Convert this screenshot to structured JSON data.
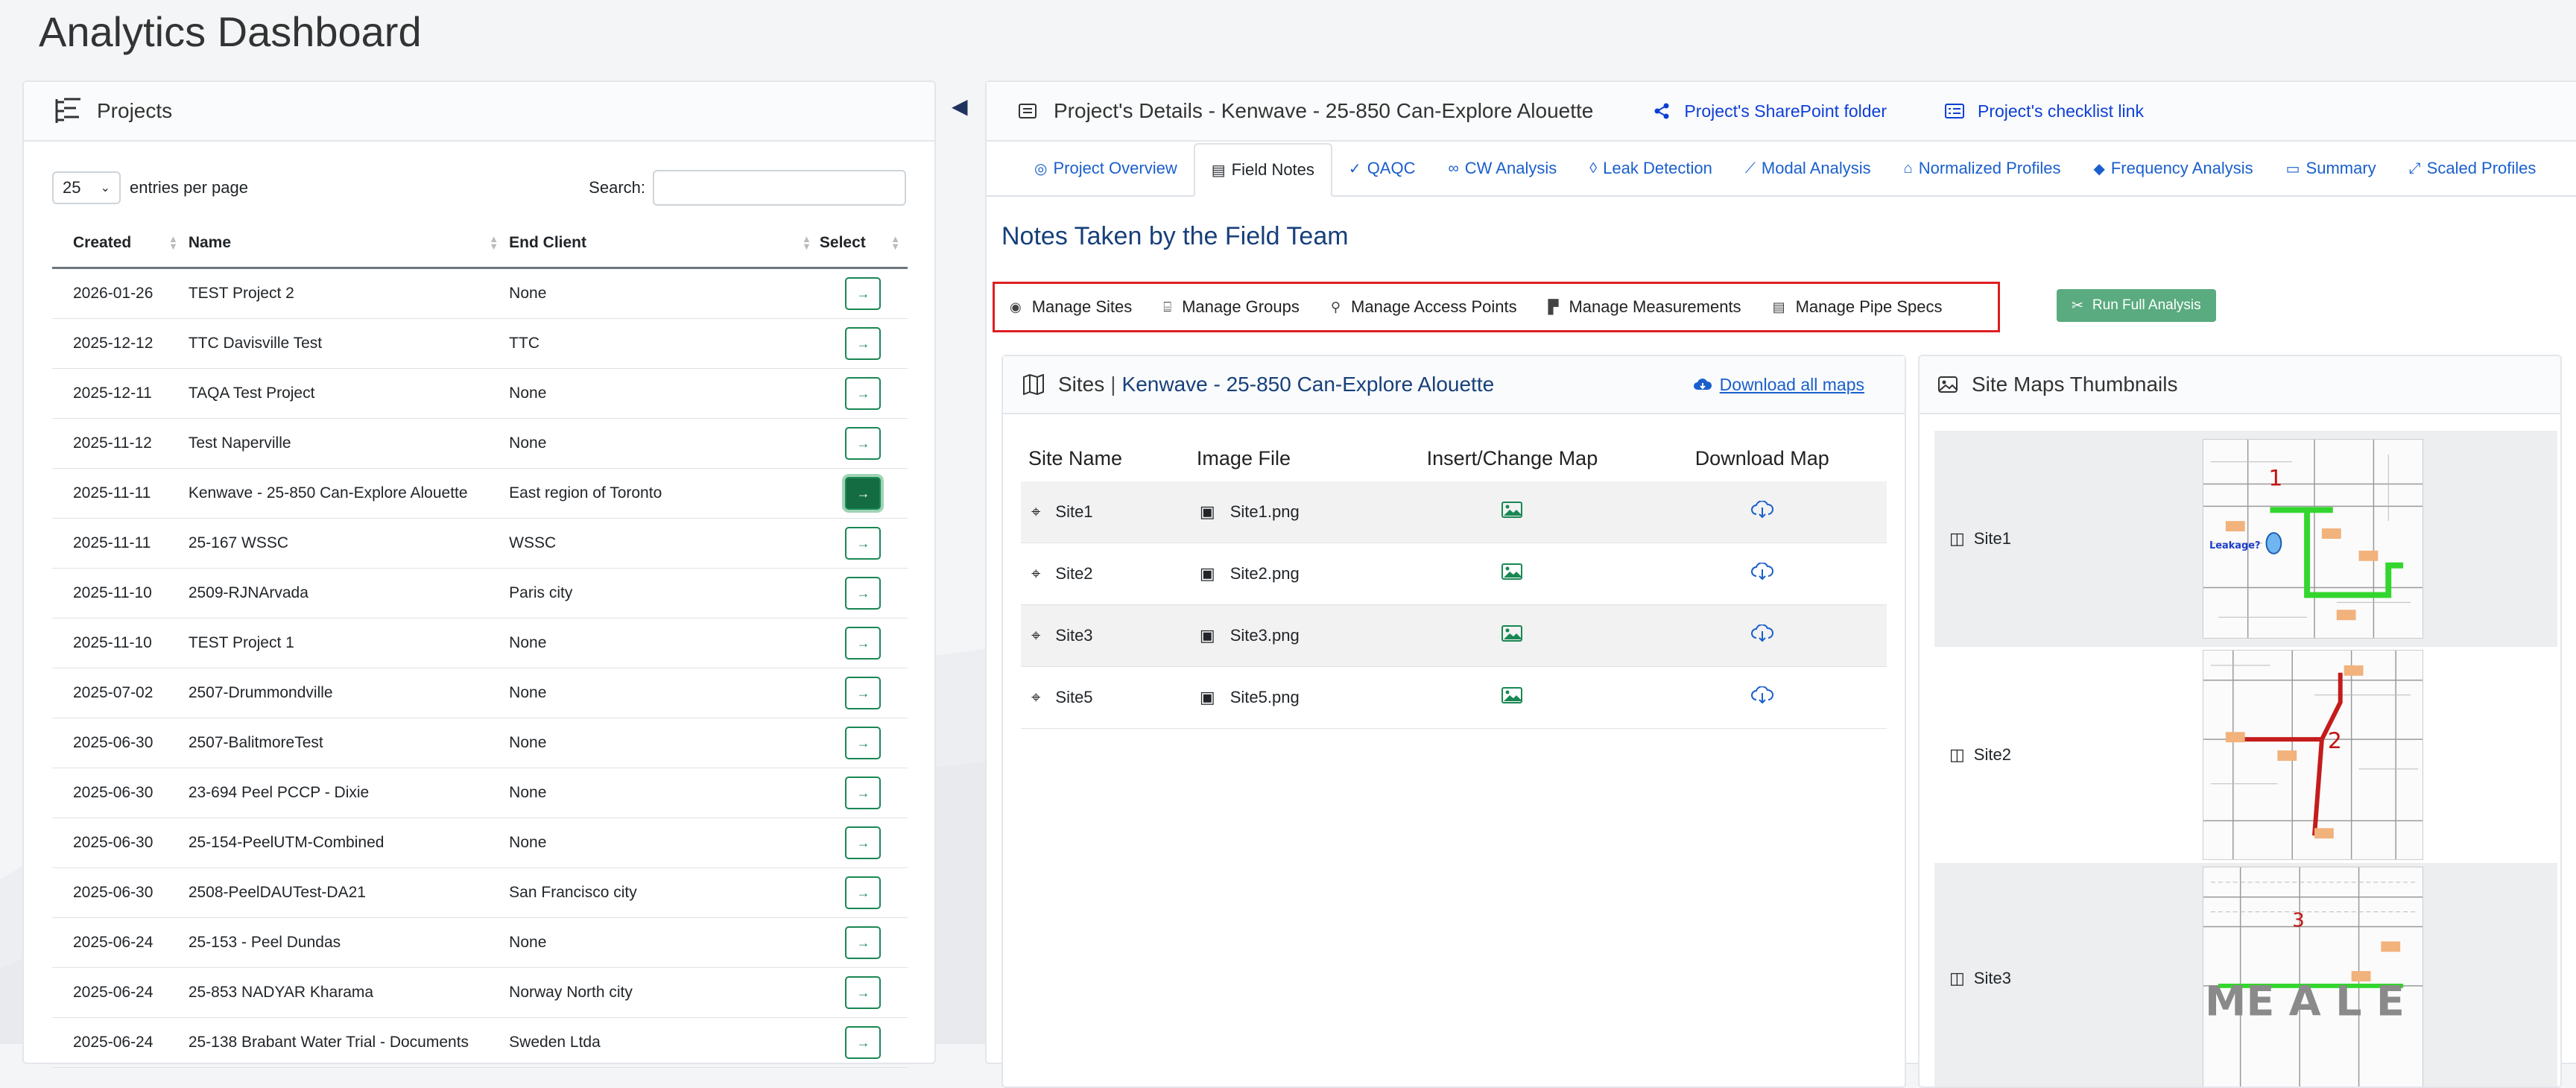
{
  "page_title": "Analytics Dashboard",
  "projects": {
    "header": "Projects",
    "entries_value": "25",
    "entries_label": "entries per page",
    "search_label": "Search:",
    "search_value": "",
    "columns": [
      "Created",
      "Name",
      "End Client",
      "Select"
    ],
    "select_glyph": "→",
    "rows": [
      {
        "created": "2026-01-26",
        "name": "TEST Project 2",
        "client": "None",
        "active": false
      },
      {
        "created": "2025-12-12",
        "name": "TTC Davisville Test",
        "client": "TTC",
        "active": false
      },
      {
        "created": "2025-12-11",
        "name": "TAQA Test Project",
        "client": "None",
        "active": false
      },
      {
        "created": "2025-11-12",
        "name": "Test Naperville",
        "client": "None",
        "active": false
      },
      {
        "created": "2025-11-11",
        "name": "Kenwave - 25-850 Can-Explore Alouette",
        "client": "East region of Toronto",
        "active": true
      },
      {
        "created": "2025-11-11",
        "name": "25-167 WSSC",
        "client": "WSSC",
        "active": false
      },
      {
        "created": "2025-11-10",
        "name": "2509-RJNArvada",
        "client": "Paris city",
        "active": false
      },
      {
        "created": "2025-11-10",
        "name": "TEST Project 1",
        "client": "None",
        "active": false
      },
      {
        "created": "2025-07-02",
        "name": "2507-Drummondville",
        "client": "None",
        "active": false
      },
      {
        "created": "2025-06-30",
        "name": "2507-BalitmoreTest",
        "client": "None",
        "active": false
      },
      {
        "created": "2025-06-30",
        "name": "23-694 Peel PCCP - Dixie",
        "client": "None",
        "active": false
      },
      {
        "created": "2025-06-30",
        "name": "25-154-PeelUTM-Combined",
        "client": "None",
        "active": false
      },
      {
        "created": "2025-06-30",
        "name": "2508-PeelDAUTest-DA21",
        "client": "San Francisco city",
        "active": false
      },
      {
        "created": "2025-06-24",
        "name": "25-153 - Peel Dundas",
        "client": "None",
        "active": false
      },
      {
        "created": "2025-06-24",
        "name": "25-853 NADYAR Kharama",
        "client": "Norway North city",
        "active": false
      },
      {
        "created": "2025-06-24",
        "name": "25-138 Brabant Water Trial - Documents",
        "client": "Sweden Ltda",
        "active": false
      }
    ]
  },
  "details": {
    "title": "Project's Details - Kenwave - 25-850 Can-Explore Alouette",
    "sharepoint_link": "Project's SharePoint folder",
    "checklist_link": "Project's checklist link",
    "tabs": [
      {
        "label": "Project Overview",
        "icon": "◎"
      },
      {
        "label": "Field Notes",
        "icon": "▤",
        "active": true
      },
      {
        "label": "QAQC",
        "icon": "✓"
      },
      {
        "label": "CW Analysis",
        "icon": "∞"
      },
      {
        "label": "Leak Detection",
        "icon": "◊"
      },
      {
        "label": "Modal Analysis",
        "icon": "⟋"
      },
      {
        "label": "Normalized Profiles",
        "icon": "⌂"
      },
      {
        "label": "Frequency Analysis",
        "icon": "◆"
      },
      {
        "label": "Summary",
        "icon": "▭"
      },
      {
        "label": "Scaled Profiles",
        "icon": "⤢"
      }
    ],
    "notes_title": "Notes Taken by the Field Team",
    "tools": [
      "Manage Sites",
      "Manage Groups",
      "Manage Access Points",
      "Manage Measurements",
      "Manage Pipe Specs"
    ],
    "run_button": "Run Full Analysis",
    "sites": {
      "title": "Sites",
      "separator": "|",
      "project": "Kenwave - 25-850 Can-Explore Alouette",
      "download_all": "Download all maps",
      "columns": [
        "Site Name",
        "Image File",
        "Insert/Change Map",
        "Download Map"
      ],
      "rows": [
        {
          "name": "Site1",
          "file": "Site1.png"
        },
        {
          "name": "Site2",
          "file": "Site2.png"
        },
        {
          "name": "Site3",
          "file": "Site3.png"
        },
        {
          "name": "Site5",
          "file": "Site5.png"
        }
      ]
    },
    "thumbnails": {
      "title": "Site Maps Thumbnails",
      "items": [
        {
          "label": "Site1",
          "map_number": "1",
          "annotation": "Leakage?"
        },
        {
          "label": "Site2",
          "map_number": "2"
        },
        {
          "label": "Site3",
          "map_number": "3",
          "watermark": "ME A L E"
        }
      ]
    }
  },
  "colors": {
    "accent": "#1a5fcc",
    "green": "#198754",
    "highlight": "#dd1f1f",
    "title_blue": "#17407a"
  }
}
